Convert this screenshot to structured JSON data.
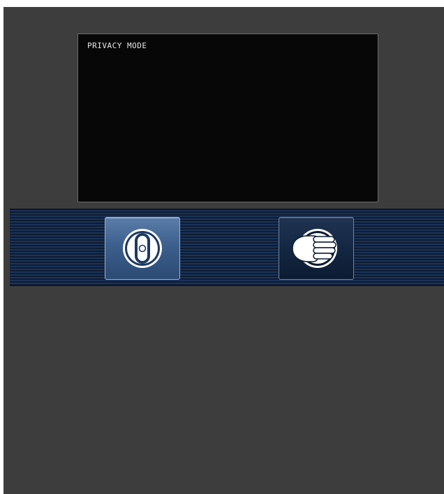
{
  "screen": {
    "label": "PRIVACY MODE"
  },
  "controls": {
    "buttons": [
      {
        "name": "privacy-shutter-button",
        "icon": "privacy-shutter-icon",
        "state": "active"
      },
      {
        "name": "raise-hand-button",
        "icon": "hand-icon",
        "state": "inactive"
      }
    ]
  },
  "colors": {
    "background": "#3d3d3d",
    "screen": "#070707",
    "bar_stripe_light": "#1b3357",
    "bar_stripe_dark": "#0e1c33",
    "active_button": "#3d5f8d",
    "inactive_button": "#132641"
  }
}
